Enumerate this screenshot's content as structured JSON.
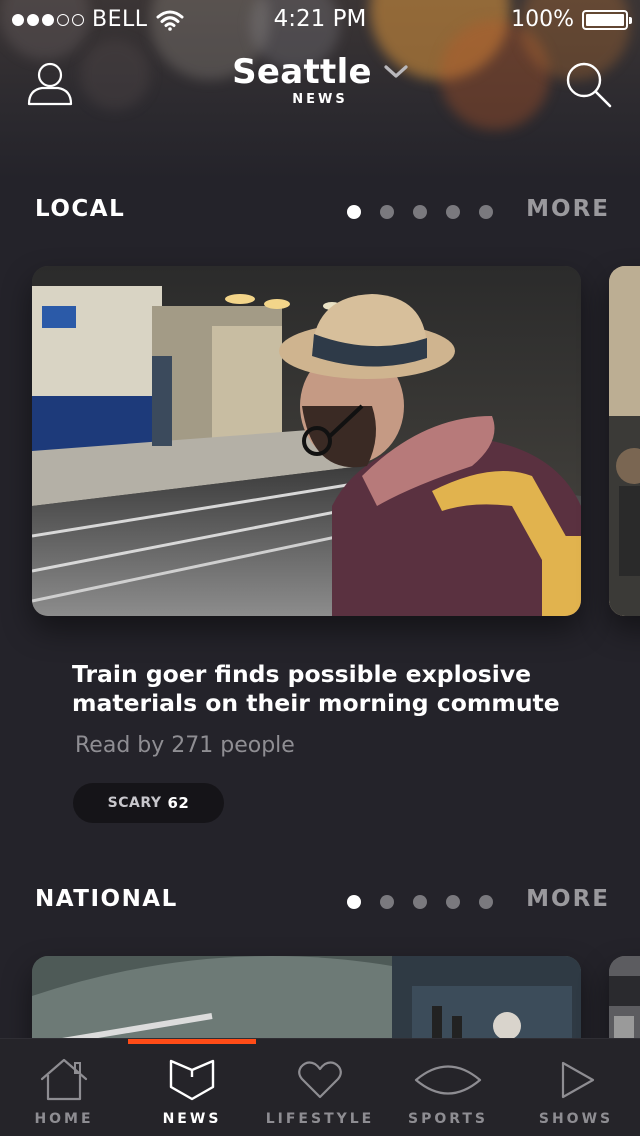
{
  "status_bar": {
    "carrier": "BELL",
    "time": "4:21 PM",
    "battery": "100%",
    "signal_bars_filled": 3,
    "signal_bars_total": 5
  },
  "header": {
    "city": "Seattle",
    "subtitle": "NEWS",
    "profile_icon": "user-icon",
    "search_icon": "search-icon",
    "dropdown_icon": "chevron-down-icon"
  },
  "sections": [
    {
      "title": "LOCAL",
      "more": "MORE",
      "page_count": 5,
      "active_page": 0,
      "article": {
        "headline": "Train goer finds possible explosive materials on their morning commute",
        "reads": "Read by 271 people",
        "tag_label": "SCARY",
        "tag_count": "62"
      }
    },
    {
      "title": "NATIONAL",
      "more": "MORE",
      "page_count": 5,
      "active_page": 0
    }
  ],
  "tabs": [
    {
      "label": "HOME",
      "icon": "home-icon"
    },
    {
      "label": "NEWS",
      "icon": "news-icon",
      "active": true
    },
    {
      "label": "LIFESTYLE",
      "icon": "heart-icon"
    },
    {
      "label": "SPORTS",
      "icon": "football-icon"
    },
    {
      "label": "SHOWS",
      "icon": "play-icon"
    }
  ],
  "colors": {
    "background": "#24232a",
    "accent": "#ff4c17",
    "muted_text": "#8f8e93",
    "tag_bg": "#151418"
  }
}
